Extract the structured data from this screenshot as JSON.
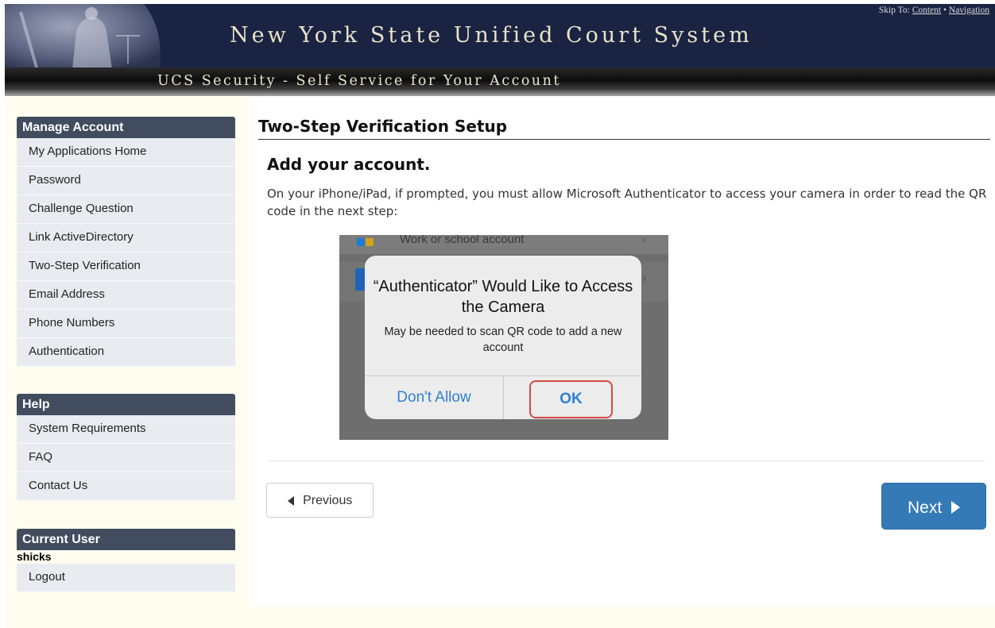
{
  "header": {
    "site_title": "New York State Unified Court System",
    "subtitle": "UCS Security - Self Service for Your Account",
    "skip_to_label": "Skip To:",
    "skip_content": "Content",
    "skip_separator": "•",
    "skip_navigation": "Navigation"
  },
  "sidebar": {
    "manage_account": {
      "title": "Manage Account",
      "items": [
        "My Applications Home",
        "Password",
        "Challenge Question",
        "Link ActiveDirectory",
        "Two-Step Verification",
        "Email Address",
        "Phone Numbers",
        "Authentication"
      ]
    },
    "help": {
      "title": "Help",
      "items": [
        "System Requirements",
        "FAQ",
        "Contact Us"
      ]
    },
    "current_user": {
      "title": "Current User",
      "username": "shicks",
      "logout_label": "Logout"
    }
  },
  "main": {
    "page_title": "Two-Step Verification Setup",
    "heading": "Add your account.",
    "instructions": "On your iPhone/iPad, if prompted, you must allow Microsoft Authenticator to access your camera in order to read the QR code in the next step:",
    "screenshot": {
      "background_row_text": "Work or school account",
      "dialog_title": "“Authenticator” Would Like to Access the Camera",
      "dialog_message": "May be needed to scan QR code to add a new account",
      "deny_label": "Don't Allow",
      "ok_label": "OK"
    },
    "previous_label": "Previous",
    "next_label": "Next"
  },
  "colors": {
    "banner": "#1a2342",
    "panel_header": "#414c5e",
    "panel_item": "#e8ecf0",
    "sidebar_bg": "#fffdf0",
    "primary_button": "#347ab7",
    "highlight": "#d94848"
  }
}
